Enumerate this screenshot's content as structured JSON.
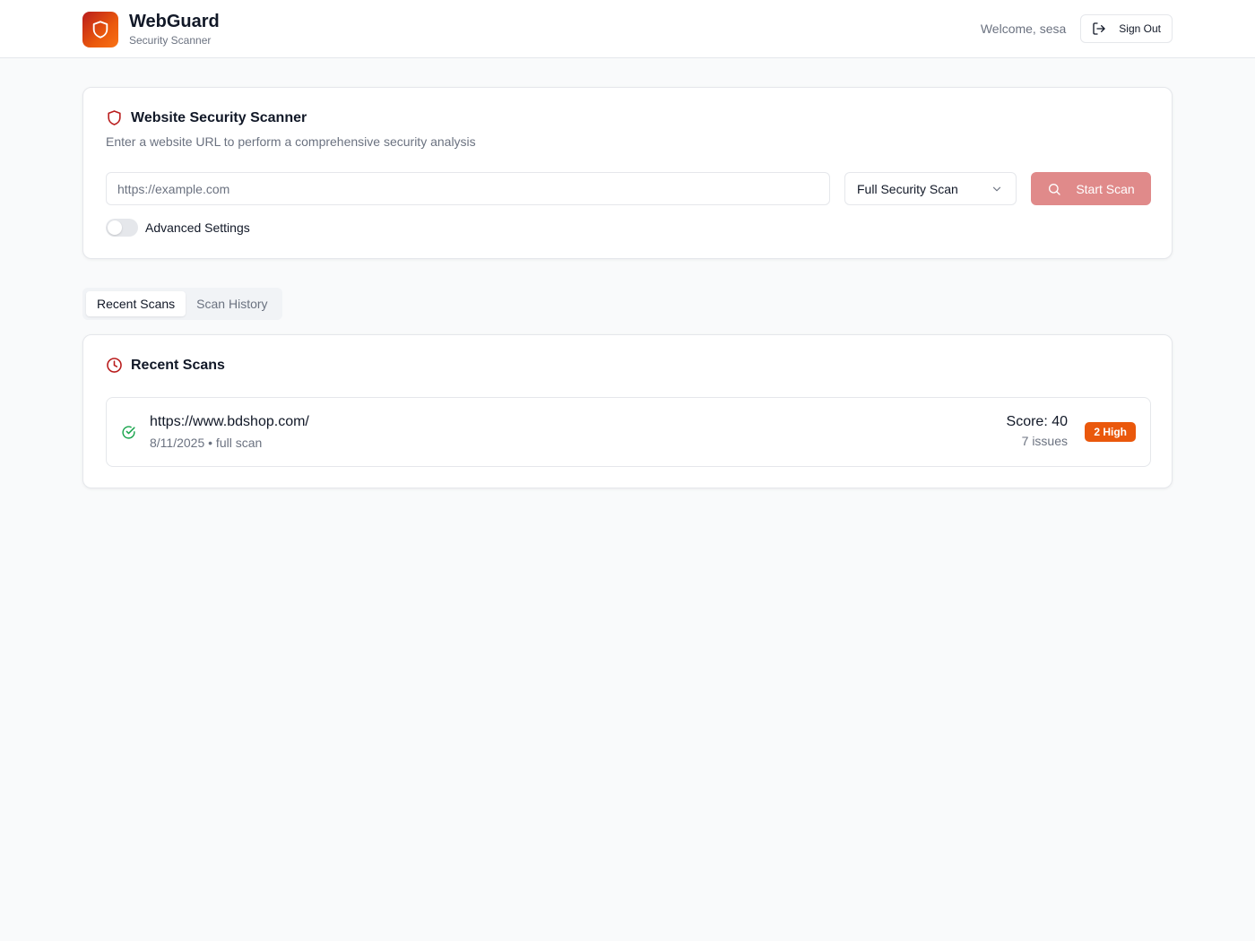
{
  "header": {
    "app_name": "WebGuard",
    "app_subtitle": "Security Scanner",
    "welcome": "Welcome, sesa",
    "sign_out_label": "Sign Out"
  },
  "scanner": {
    "title": "Website Security Scanner",
    "description": "Enter a website URL to perform a comprehensive security analysis",
    "url_placeholder": "https://example.com",
    "url_value": "",
    "scan_type": "Full Security Scan",
    "start_label": "Start Scan",
    "advanced_label": "Advanced Settings",
    "advanced_enabled": false
  },
  "tabs": [
    {
      "label": "Recent Scans",
      "active": true
    },
    {
      "label": "Scan History",
      "active": false
    }
  ],
  "recent": {
    "title": "Recent Scans",
    "items": [
      {
        "url": "https://www.bdshop.com/",
        "meta": "8/11/2025 • full scan",
        "score": "Score: 40",
        "issues": "7 issues",
        "badge": "2 High"
      }
    ]
  },
  "colors": {
    "accent": "#b91c1c",
    "start_button": "#e08a8a",
    "high_badge": "#ea580c",
    "success": "#16a34a"
  }
}
